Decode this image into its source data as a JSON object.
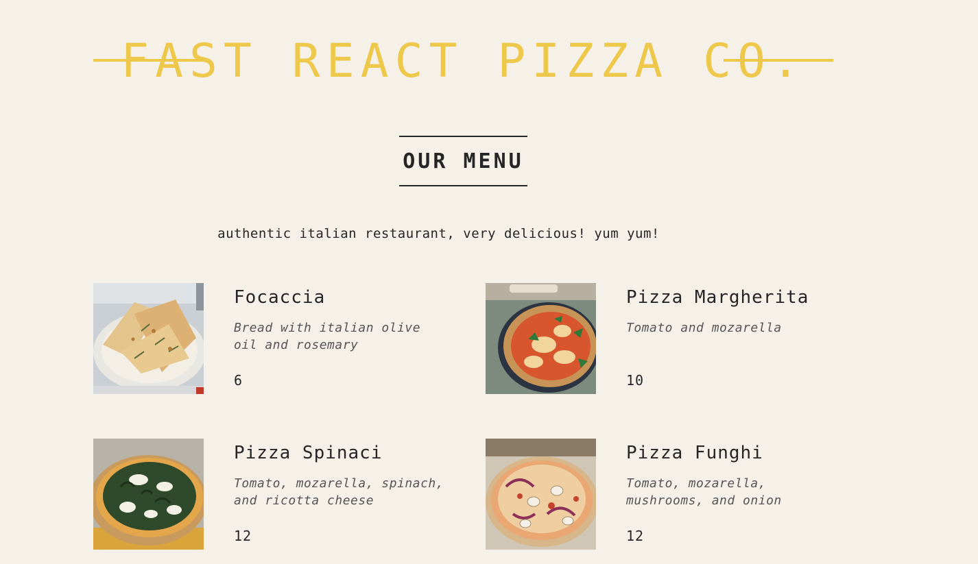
{
  "header": {
    "title": "Fast React Pizza Co."
  },
  "menu": {
    "title": "Our Menu",
    "tagline": "authentic italian restaurant, very delicious! yum yum!"
  },
  "pizzas": [
    {
      "name": "Focaccia",
      "ingredients": "Bread with italian olive oil and rosemary",
      "price": "6",
      "photo": "focaccia-photo"
    },
    {
      "name": "Pizza Margherita",
      "ingredients": "Tomato and mozarella",
      "price": "10",
      "photo": "margherita-photo"
    },
    {
      "name": "Pizza Spinaci",
      "ingredients": "Tomato, mozarella, spinach, and ricotta cheese",
      "price": "12",
      "photo": "spinaci-photo"
    },
    {
      "name": "Pizza Funghi",
      "ingredients": "Tomato, mozarella, mushrooms, and onion",
      "price": "12",
      "photo": "funghi-photo"
    }
  ],
  "colors": {
    "background": "#f6f1e8",
    "accent": "#edc84b",
    "text": "#252525"
  }
}
